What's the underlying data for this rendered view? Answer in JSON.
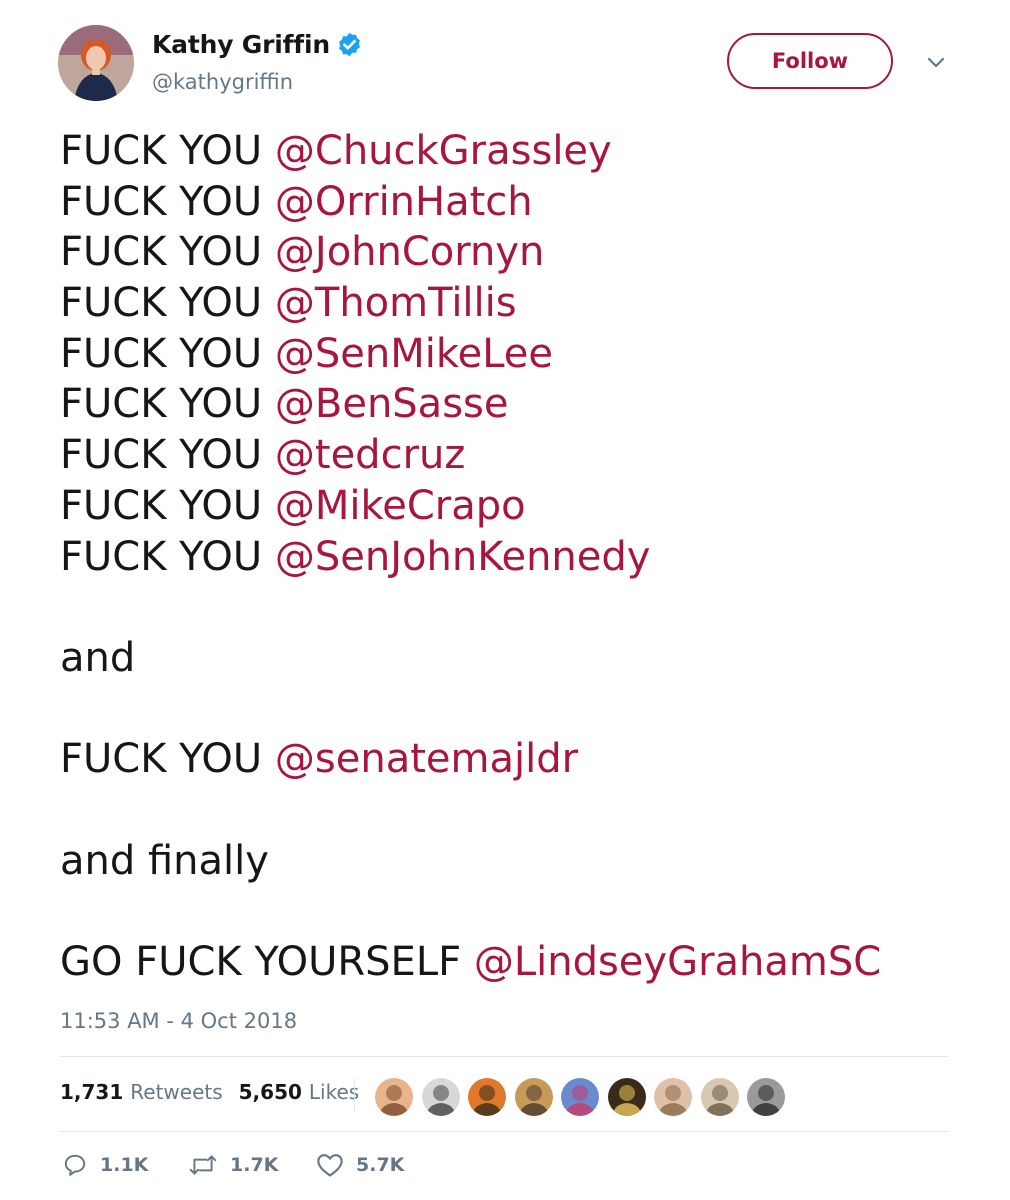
{
  "user": {
    "display_name": "Kathy Griffin",
    "handle": "@kathygriffin",
    "verified": true
  },
  "follow_button": {
    "label": "Follow"
  },
  "menu_icon": "chevron-down-icon",
  "tweet": {
    "lines": [
      {
        "prefix": "FUCK YOU ",
        "mention": "@ChuckGrassley"
      },
      {
        "prefix": "FUCK YOU ",
        "mention": "@OrrinHatch"
      },
      {
        "prefix": "FUCK YOU ",
        "mention": "@JohnCornyn"
      },
      {
        "prefix": "FUCK YOU ",
        "mention": "@ThomTillis"
      },
      {
        "prefix": "FUCK YOU ",
        "mention": "@SenMikeLee"
      },
      {
        "prefix": "FUCK YOU ",
        "mention": "@BenSasse"
      },
      {
        "prefix": "FUCK YOU ",
        "mention": "@tedcruz"
      },
      {
        "prefix": "FUCK YOU ",
        "mention": "@MikeCrapo"
      },
      {
        "prefix": "FUCK YOU ",
        "mention": "@SenJohnKennedy"
      },
      {
        "blank": true
      },
      {
        "prefix": "and",
        "mention": ""
      },
      {
        "blank": true
      },
      {
        "prefix": "FUCK YOU ",
        "mention": "@senatemajldr"
      },
      {
        "blank": true
      },
      {
        "prefix": "and finally",
        "mention": ""
      },
      {
        "blank": true
      },
      {
        "prefix": "GO FUCK YOURSELF ",
        "mention": "@LindseyGrahamSC"
      }
    ],
    "timestamp": "11:53 AM - 4 Oct 2018"
  },
  "stats": {
    "retweets_count": "1,731",
    "retweets_label": "Retweets",
    "likes_count": "5,650",
    "likes_label": "Likes"
  },
  "likers": [
    {
      "colors": [
        "#e8b48c",
        "#7a4a2e"
      ]
    },
    {
      "colors": [
        "#d8d8d8",
        "#444444"
      ]
    },
    {
      "colors": [
        "#e07a2a",
        "#3a2a1a"
      ]
    },
    {
      "colors": [
        "#c89a5a",
        "#4a3a2a"
      ]
    },
    {
      "colors": [
        "#6a8ad0",
        "#c83a6a"
      ]
    },
    {
      "colors": [
        "#3a2a1a",
        "#e8c85a"
      ]
    },
    {
      "colors": [
        "#e0c0a8",
        "#8a6a4a"
      ]
    },
    {
      "colors": [
        "#d8c8b0",
        "#6a5a4a"
      ]
    },
    {
      "colors": [
        "#9a9a9a",
        "#2a2a2a"
      ]
    }
  ],
  "actions": {
    "reply_count": "1.1K",
    "retweet_count": "1.7K",
    "like_count": "5.7K"
  },
  "colors": {
    "accent": "#a8153e",
    "text": "#14171a",
    "secondary": "#657786",
    "verified": "#1da1f2",
    "divider": "#e1e8ed"
  }
}
